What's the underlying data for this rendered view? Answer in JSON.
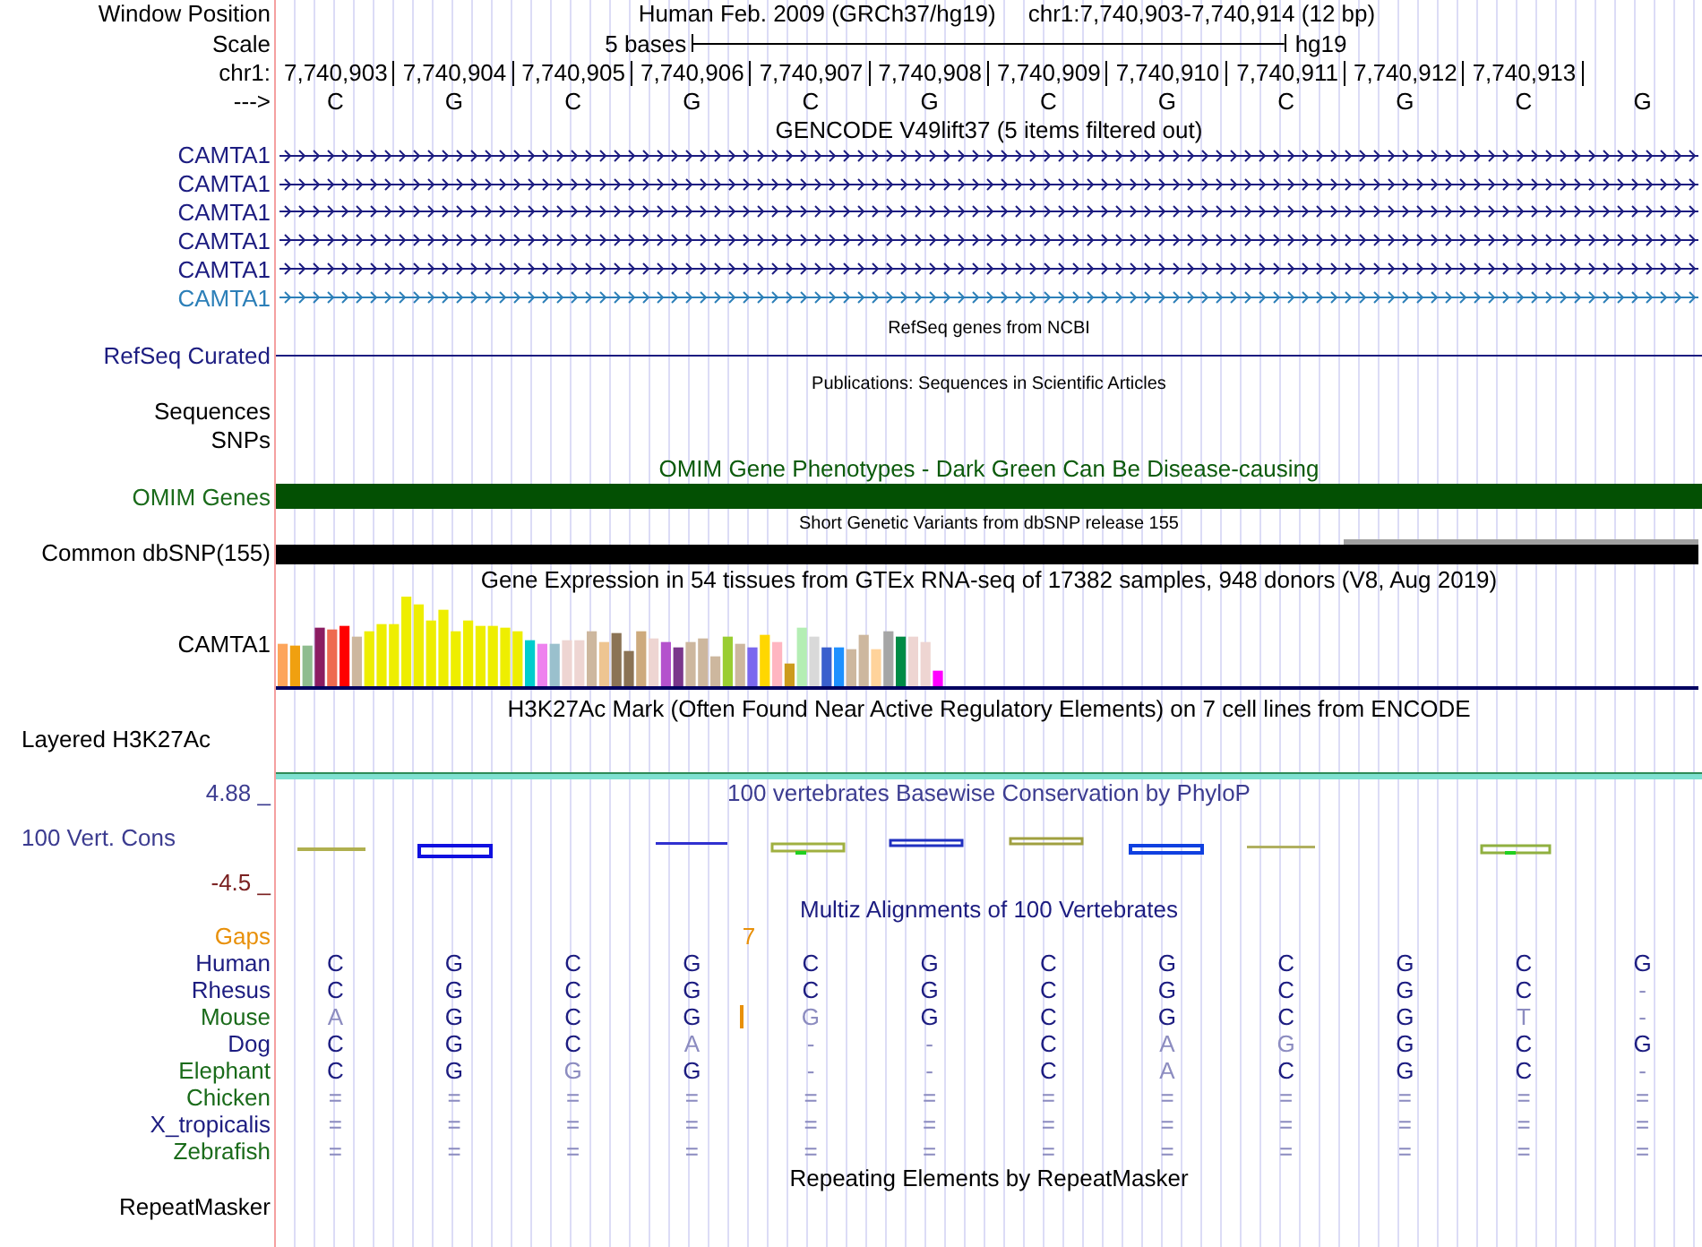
{
  "header": {
    "position_label": "Window Position",
    "assembly": "Human Feb. 2009 (GRCh37/hg19)",
    "range": "chr1:7,740,903-7,740,914 (12 bp)",
    "scale_label": "Scale",
    "scale_text": "5 bases",
    "scale_db": "hg19",
    "chrom_label": "chr1:",
    "ticks": [
      "7,740,903",
      "7,740,904",
      "7,740,905",
      "7,740,906",
      "7,740,907",
      "7,740,908",
      "7,740,909",
      "7,740,910",
      "7,740,911",
      "7,740,912",
      "7,740,913"
    ],
    "strand_label": "--->",
    "bases": [
      "C",
      "G",
      "C",
      "G",
      "C",
      "G",
      "C",
      "G",
      "C",
      "G",
      "C",
      "G"
    ]
  },
  "gencode": {
    "title": "GENCODE V49lift37 (5 items filtered out)",
    "genes": [
      {
        "name": "CAMTA1",
        "color": "#1c1c80"
      },
      {
        "name": "CAMTA1",
        "color": "#1c1c80"
      },
      {
        "name": "CAMTA1",
        "color": "#1c1c80"
      },
      {
        "name": "CAMTA1",
        "color": "#1c1c80"
      },
      {
        "name": "CAMTA1",
        "color": "#1c1c80"
      },
      {
        "name": "CAMTA1",
        "color": "#2c7fb8"
      }
    ]
  },
  "refseq": {
    "title": "RefSeq genes from NCBI",
    "label": "RefSeq Curated"
  },
  "publications": {
    "title": "Publications: Sequences in Scientific Articles",
    "labels": [
      "Sequences",
      "SNPs"
    ]
  },
  "omim": {
    "title": "OMIM Gene Phenotypes - Dark Green Can Be Disease-causing",
    "label": "OMIM Genes"
  },
  "dbsnp": {
    "title": "Short Genetic Variants from dbSNP release 155",
    "label": "Common dbSNP(155)"
  },
  "gtex": {
    "title": "Gene Expression in 54 tissues from GTEx RNA-seq of 17382 samples, 948 donors (V8, Aug 2019)",
    "label": "CAMTA1"
  },
  "h3k27ac": {
    "title": "H3K27Ac Mark (Often Found Near Active Regulatory Elements) on 7 cell lines from ENCODE",
    "label": "Layered H3K27Ac"
  },
  "phylop": {
    "title": "100 vertebrates Basewise Conservation by PhyloP",
    "label": "100 Vert. Cons",
    "max": "4.88 _",
    "min": "-4.5 _"
  },
  "multiz": {
    "title": "Multiz Alignments of 100 Vertebrates",
    "gaps_label": "Gaps",
    "species": [
      {
        "name": "Human",
        "color": "#1c1c80",
        "bases": [
          {
            "b": "C",
            "match": true
          },
          {
            "b": "G",
            "match": true
          },
          {
            "b": "C",
            "match": true
          },
          {
            "b": "G",
            "match": true
          },
          {
            "b": "C",
            "match": true
          },
          {
            "b": "G",
            "match": true
          },
          {
            "b": "C",
            "match": true
          },
          {
            "b": "G",
            "match": true
          },
          {
            "b": "C",
            "match": true
          },
          {
            "b": "G",
            "match": true
          },
          {
            "b": "C",
            "match": true
          },
          {
            "b": "G",
            "match": true
          }
        ]
      },
      {
        "name": "Rhesus",
        "color": "#1c1c80",
        "bases": [
          {
            "b": "C",
            "match": true
          },
          {
            "b": "G",
            "match": true
          },
          {
            "b": "C",
            "match": true
          },
          {
            "b": "G",
            "match": true
          },
          {
            "b": "C",
            "match": true
          },
          {
            "b": "G",
            "match": true
          },
          {
            "b": "C",
            "match": true
          },
          {
            "b": "G",
            "match": true
          },
          {
            "b": "C",
            "match": true
          },
          {
            "b": "G",
            "match": true
          },
          {
            "b": "C",
            "match": true
          },
          {
            "b": "-",
            "match": false
          }
        ]
      },
      {
        "name": "Mouse",
        "color": "#1a6b1a",
        "bases": [
          {
            "b": "A",
            "match": false
          },
          {
            "b": "G",
            "match": true
          },
          {
            "b": "C",
            "match": true
          },
          {
            "b": "G",
            "match": true
          },
          {
            "b": "G",
            "match": false,
            "insertion": "7"
          },
          {
            "b": "G",
            "match": true
          },
          {
            "b": "C",
            "match": true
          },
          {
            "b": "G",
            "match": true
          },
          {
            "b": "C",
            "match": true
          },
          {
            "b": "G",
            "match": true
          },
          {
            "b": "T",
            "match": false
          },
          {
            "b": "-",
            "match": false
          }
        ]
      },
      {
        "name": "Dog",
        "color": "#1c1c80",
        "bases": [
          {
            "b": "C",
            "match": true
          },
          {
            "b": "G",
            "match": true
          },
          {
            "b": "C",
            "match": true
          },
          {
            "b": "A",
            "match": false
          },
          {
            "b": "-",
            "match": false
          },
          {
            "b": "-",
            "match": false
          },
          {
            "b": "C",
            "match": true
          },
          {
            "b": "A",
            "match": false
          },
          {
            "b": "G",
            "match": false
          },
          {
            "b": "G",
            "match": true
          },
          {
            "b": "C",
            "match": true
          },
          {
            "b": "G",
            "match": true
          }
        ]
      },
      {
        "name": "Elephant",
        "color": "#1a6b1a",
        "bases": [
          {
            "b": "C",
            "match": true
          },
          {
            "b": "G",
            "match": true
          },
          {
            "b": "G",
            "match": false
          },
          {
            "b": "G",
            "match": true
          },
          {
            "b": "-",
            "match": false
          },
          {
            "b": "-",
            "match": false
          },
          {
            "b": "C",
            "match": true
          },
          {
            "b": "A",
            "match": false
          },
          {
            "b": "C",
            "match": true
          },
          {
            "b": "G",
            "match": true
          },
          {
            "b": "C",
            "match": true
          },
          {
            "b": "-",
            "match": false
          }
        ]
      },
      {
        "name": "Chicken",
        "color": "#1a6b1a",
        "bases": [
          {
            "b": "=",
            "match": false
          },
          {
            "b": "=",
            "match": false
          },
          {
            "b": "=",
            "match": false
          },
          {
            "b": "=",
            "match": false
          },
          {
            "b": "=",
            "match": false
          },
          {
            "b": "=",
            "match": false
          },
          {
            "b": "=",
            "match": false
          },
          {
            "b": "=",
            "match": false
          },
          {
            "b": "=",
            "match": false
          },
          {
            "b": "=",
            "match": false
          },
          {
            "b": "=",
            "match": false
          },
          {
            "b": "=",
            "match": false
          }
        ]
      },
      {
        "name": "X_tropicalis",
        "color": "#1c1c80",
        "bases": [
          {
            "b": "=",
            "match": false
          },
          {
            "b": "=",
            "match": false
          },
          {
            "b": "=",
            "match": false
          },
          {
            "b": "=",
            "match": false
          },
          {
            "b": "=",
            "match": false
          },
          {
            "b": "=",
            "match": false
          },
          {
            "b": "=",
            "match": false
          },
          {
            "b": "=",
            "match": false
          },
          {
            "b": "=",
            "match": false
          },
          {
            "b": "=",
            "match": false
          },
          {
            "b": "=",
            "match": false
          },
          {
            "b": "=",
            "match": false
          }
        ]
      },
      {
        "name": "Zebrafish",
        "color": "#1a6b1a",
        "bases": [
          {
            "b": "=",
            "match": false
          },
          {
            "b": "=",
            "match": false
          },
          {
            "b": "=",
            "match": false
          },
          {
            "b": "=",
            "match": false
          },
          {
            "b": "=",
            "match": false
          },
          {
            "b": "=",
            "match": false
          },
          {
            "b": "=",
            "match": false
          },
          {
            "b": "=",
            "match": false
          },
          {
            "b": "=",
            "match": false
          },
          {
            "b": "=",
            "match": false
          },
          {
            "b": "=",
            "match": false
          },
          {
            "b": "=",
            "match": false
          }
        ]
      }
    ]
  },
  "repeatmasker": {
    "title": "Repeating Elements by RepeatMasker",
    "label": "RepeatMasker"
  }
}
